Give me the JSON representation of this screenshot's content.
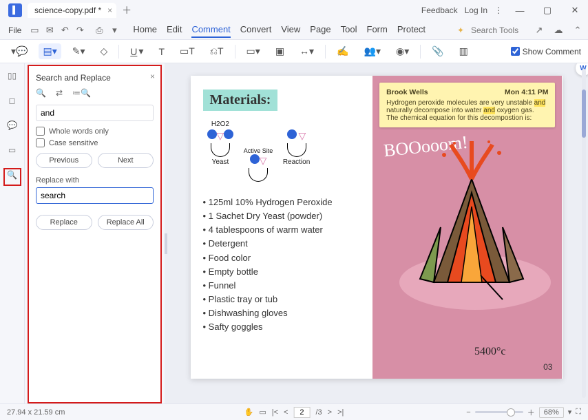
{
  "title": {
    "filename": "science-copy.pdf *",
    "feedback": "Feedback",
    "login": "Log In"
  },
  "menus": {
    "file": "File",
    "items": [
      "Home",
      "Edit",
      "Comment",
      "Convert",
      "View",
      "Page",
      "Tool",
      "Form",
      "Protect"
    ],
    "active": "Comment",
    "search_placeholder": "Search Tools"
  },
  "ribbon": {
    "show_comment": "Show Comment"
  },
  "panel": {
    "title": "Search and Replace",
    "find_value": "and",
    "whole_words": "Whole words only",
    "case_sensitive": "Case sensitive",
    "previous": "Previous",
    "next": "Next",
    "replace_with_label": "Replace with",
    "replace_value": "search",
    "replace": "Replace",
    "replace_all": "Replace All"
  },
  "doc": {
    "materials_heading": "Materials:",
    "diagram": {
      "h2o2": "H2O2",
      "active_site": "Active Site",
      "yeast": "Yeast",
      "reaction": "Reaction"
    },
    "items": [
      "125ml 10% Hydrogen Peroxide",
      "1 Sachet Dry Yeast (powder)",
      "4 tablespoons of warm water",
      "Detergent",
      "Food color",
      "Empty bottle",
      "Funnel",
      "Plastic tray or tub",
      "Dishwashing gloves",
      "Safty goggles"
    ],
    "note": {
      "author": "Brook Wells",
      "time": "Mon 4:11 PM",
      "l1a": "Hydrogen peroxide molecules are very unstable ",
      "hl1": "and",
      "l2a": " naturally decompose into water ",
      "hl2": "and",
      "l2b": " oxygen gas.",
      "l3": "The chemical equation for this decompostion is:"
    },
    "boom": "BOOooom!",
    "temp": "5400°c",
    "page_num": "03"
  },
  "status": {
    "dims": "27.94 x 21.59 cm",
    "page": "2",
    "total": "/3",
    "zoom": "68%"
  }
}
